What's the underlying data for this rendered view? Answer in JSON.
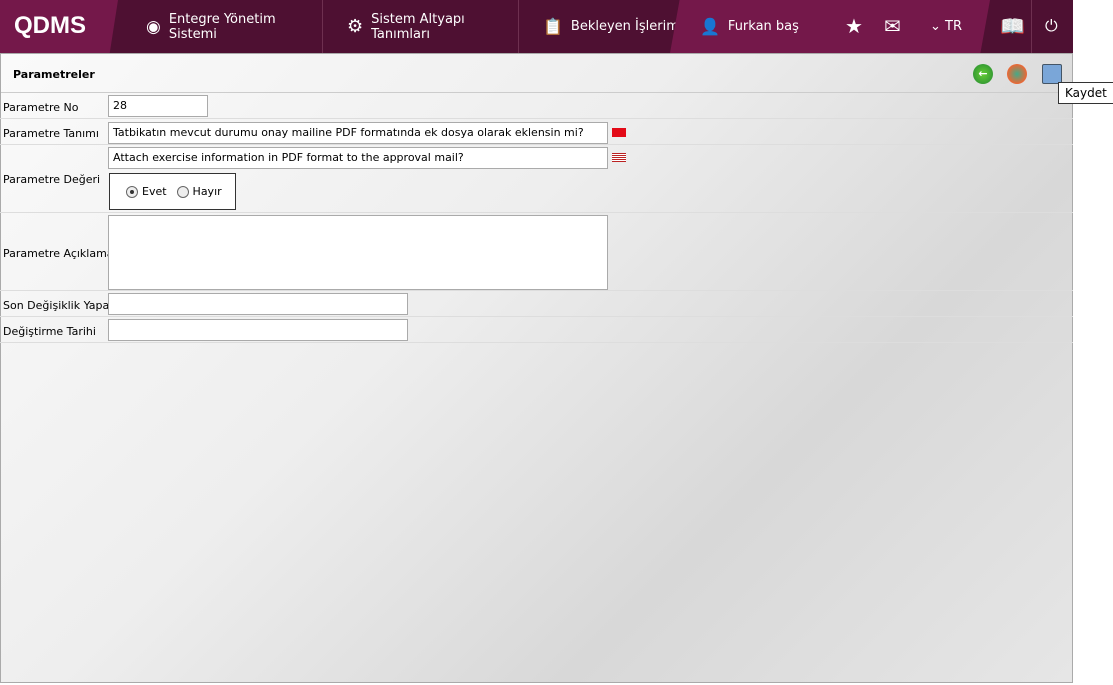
{
  "header": {
    "logo": "QDMS",
    "nav": [
      "Entegre Yönetim Sistemi",
      "Sistem Altyapı Tanımları",
      "Bekleyen İşlerim"
    ],
    "user": "Furkan baş",
    "language": "TR"
  },
  "page": {
    "title": "Parametreler",
    "tooltip": "Kaydet"
  },
  "form": {
    "no_label": "Parametre No",
    "no_value": "28",
    "def_label": "Parametre Tanımı",
    "def_tr": "Tatbikatın mevcut durumu onay mailine PDF formatında ek dosya olarak eklensin mi?",
    "def_en": "Attach exercise information in PDF format to the approval mail?",
    "value_label": "Parametre Değeri",
    "yes": "Evet",
    "no": "Hayır",
    "desc_label": "Parametre Açıklaması",
    "desc_value": "",
    "modified_by_label": "Son Değişiklik Yapan",
    "modified_by_value": "",
    "date_label": "Değiştirme Tarihi",
    "date_value": ""
  }
}
